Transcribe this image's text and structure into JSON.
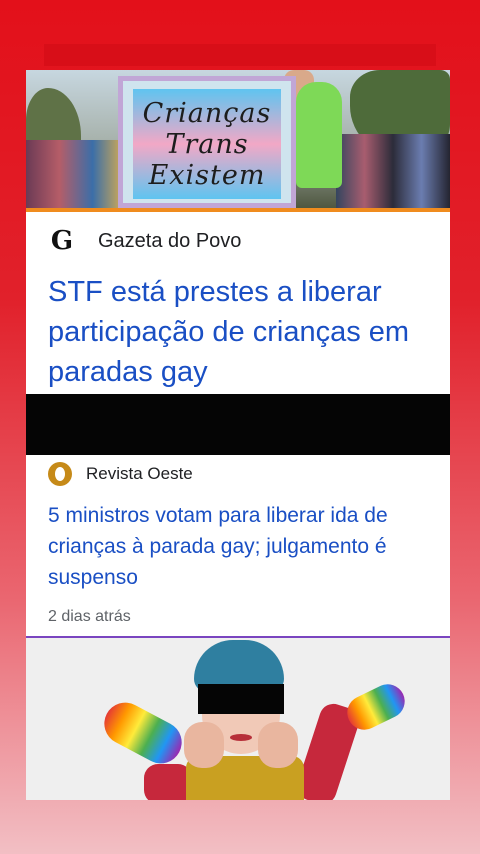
{
  "hero1": {
    "banner_lines": [
      "Crianças",
      "Trans",
      "Existem"
    ]
  },
  "article1": {
    "source": "Gazeta do Povo",
    "source_logo": "G",
    "headline": "STF está prestes a liberar participação de crianças em paradas gay"
  },
  "article2": {
    "source": "Revista Oeste",
    "headline": "5 ministros votam para liberar ida de crianças à parada gay; julgamento é suspenso",
    "timestamp": "2 dias atrás"
  },
  "colors": {
    "headline_blue": "#1a4fc4",
    "frame_red": "#e3101a",
    "accent_orange": "#f08c1e",
    "divider_purple": "#7a45c0"
  }
}
